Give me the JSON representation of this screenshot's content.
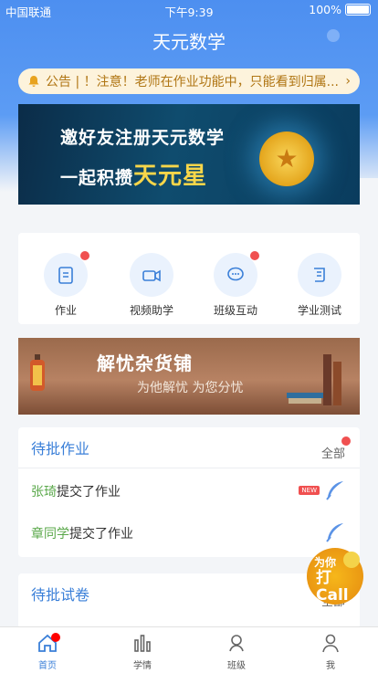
{
  "status": {
    "carrier": "中国联通",
    "time": "下午9:39",
    "battery": "100%"
  },
  "header": {
    "title": "天元数学"
  },
  "notice": {
    "text": "公告 | ！注意！老师在作业功能中，只能看到归属..."
  },
  "banner1": {
    "line1": "邀好友注册天元数学",
    "line2_prefix": "一起积攒",
    "line2_highlight": "天元星"
  },
  "features": [
    {
      "label": "作业",
      "icon": "clipboard-icon",
      "badge": true
    },
    {
      "label": "视频助学",
      "icon": "video-camera-icon",
      "badge": false
    },
    {
      "label": "班级互动",
      "icon": "chat-bubble-icon",
      "badge": true
    },
    {
      "label": "学业测试",
      "icon": "scroll-icon",
      "badge": false
    }
  ],
  "banner2": {
    "title": "解忧杂货铺",
    "subtitle": "为他解忧  为您分忧"
  },
  "pending_homework": {
    "title": "待批作业",
    "all_label": "全部",
    "rows": [
      {
        "name": "张琦",
        "action": "提交了作业",
        "new": true,
        "new_label": "NEW"
      },
      {
        "name": "章同学",
        "action": "提交了作业",
        "new": false
      }
    ]
  },
  "pending_papers": {
    "title": "待批试卷",
    "all_label": "全部"
  },
  "call_button": {
    "line1": "为你",
    "line2": "打Call"
  },
  "tabbar": [
    {
      "label": "首页",
      "icon": "home-icon",
      "active": true
    },
    {
      "label": "学情",
      "icon": "bar-chart-icon",
      "active": false
    },
    {
      "label": "班级",
      "icon": "class-icon",
      "active": false
    },
    {
      "label": "我",
      "icon": "person-icon",
      "active": false
    }
  ],
  "colors": {
    "primary": "#4d8ff0",
    "badge": "#f05050",
    "name_green": "#5aa84a"
  }
}
